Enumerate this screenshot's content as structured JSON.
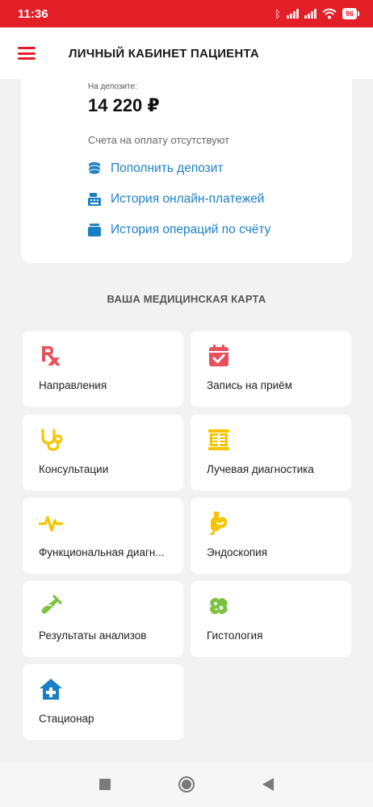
{
  "status_bar": {
    "time": "11:36",
    "battery": "96"
  },
  "app_bar": {
    "title": "ЛИЧНЫЙ КАБИНЕТ ПАЦИЕНТА"
  },
  "deposit": {
    "label": "На депозите:",
    "amount": "14 220 ₽",
    "no_bills": "Счета на оплату отсутствуют",
    "links": [
      {
        "label": "Пополнить депозит",
        "icon": "coins-icon"
      },
      {
        "label": "История онлайн-платежей",
        "icon": "cash-register-icon"
      },
      {
        "label": "История операций по счёту",
        "icon": "wallet-icon"
      }
    ]
  },
  "medical_card": {
    "title": "ВАША МЕДИЦИНСКАЯ КАРТА",
    "tiles": [
      {
        "label": "Направления",
        "icon": "prescription-icon",
        "color": "#e8505b"
      },
      {
        "label": "Запись на приём",
        "icon": "calendar-check-icon",
        "color": "#e8505b"
      },
      {
        "label": "Консультации",
        "icon": "stethoscope-icon",
        "color": "#f5c400"
      },
      {
        "label": "Лучевая диагностика",
        "icon": "xray-icon",
        "color": "#f5c400"
      },
      {
        "label": "Функциональная диагн...",
        "icon": "pulse-icon",
        "color": "#f5c400"
      },
      {
        "label": "Эндоскопия",
        "icon": "stomach-icon",
        "color": "#f5c400"
      },
      {
        "label": "Результаты анализов",
        "icon": "test-tube-icon",
        "color": "#7cc242"
      },
      {
        "label": "Гистология",
        "icon": "bacteria-icon",
        "color": "#7cc242"
      },
      {
        "label": "Стационар",
        "icon": "hospital-icon",
        "color": "#1b7fc4"
      }
    ]
  },
  "colors": {
    "brand": "#e41e26",
    "link": "#1b7fc4",
    "background": "#f2f2f2"
  }
}
